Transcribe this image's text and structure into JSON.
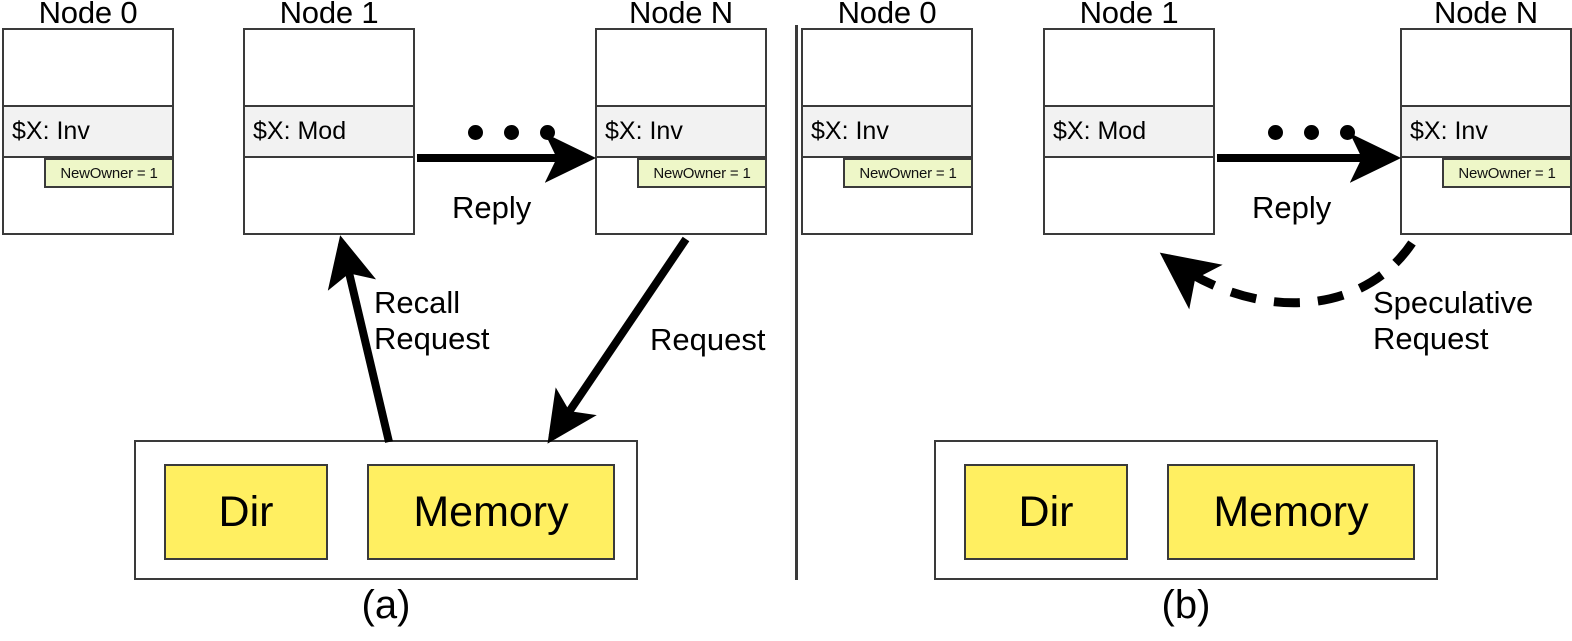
{
  "figure": {
    "background": "#ffffff",
    "box_border_color": "#3a3a3a",
    "state_row_color": "#f2f2f2",
    "newowner_color": "#eef7c8",
    "memory_cell_color": "#ffef61"
  },
  "panels": [
    {
      "id": "a",
      "caption": "(a)",
      "nodes": [
        {
          "title": "Node 0",
          "state": "$X: Inv",
          "newowner": "NewOwner = 1",
          "has_newowner": true
        },
        {
          "title": "Node 1",
          "state": "$X: Mod",
          "newowner": "",
          "has_newowner": false
        },
        {
          "title": "Node N",
          "state": "$X: Inv",
          "newowner": "NewOwner = 1",
          "has_newowner": true
        }
      ],
      "ellipsis": "• • •",
      "memory": {
        "dir_label": "Dir",
        "memory_label": "Memory"
      },
      "edges": [
        {
          "label": "Reply",
          "style": "solid",
          "from": "Node 1",
          "to": "Node N"
        },
        {
          "label": "Recall\nRequest",
          "style": "solid",
          "from": "Memory",
          "to": "Node 1"
        },
        {
          "label": "Request",
          "style": "solid",
          "from": "Node N",
          "to": "Memory"
        }
      ]
    },
    {
      "id": "b",
      "caption": "(b)",
      "nodes": [
        {
          "title": "Node 0",
          "state": "$X: Inv",
          "newowner": "NewOwner = 1",
          "has_newowner": true
        },
        {
          "title": "Node 1",
          "state": "$X: Mod",
          "newowner": "",
          "has_newowner": false
        },
        {
          "title": "Node N",
          "state": "$X: Inv",
          "newowner": "NewOwner = 1",
          "has_newowner": true
        }
      ],
      "ellipsis": "• • •",
      "memory": {
        "dir_label": "Dir",
        "memory_label": "Memory"
      },
      "edges": [
        {
          "label": "Reply",
          "style": "solid",
          "from": "Node 1",
          "to": "Node N"
        },
        {
          "label": "Speculative\nRequest",
          "style": "dashed",
          "from": "Node N",
          "to": "Node 1"
        }
      ]
    }
  ],
  "labels": {
    "reply_a": "Reply",
    "recall_request_a": "Recall\nRequest",
    "request_a": "Request",
    "reply_b": "Reply",
    "speculative_request_b": "Speculative\nRequest"
  }
}
